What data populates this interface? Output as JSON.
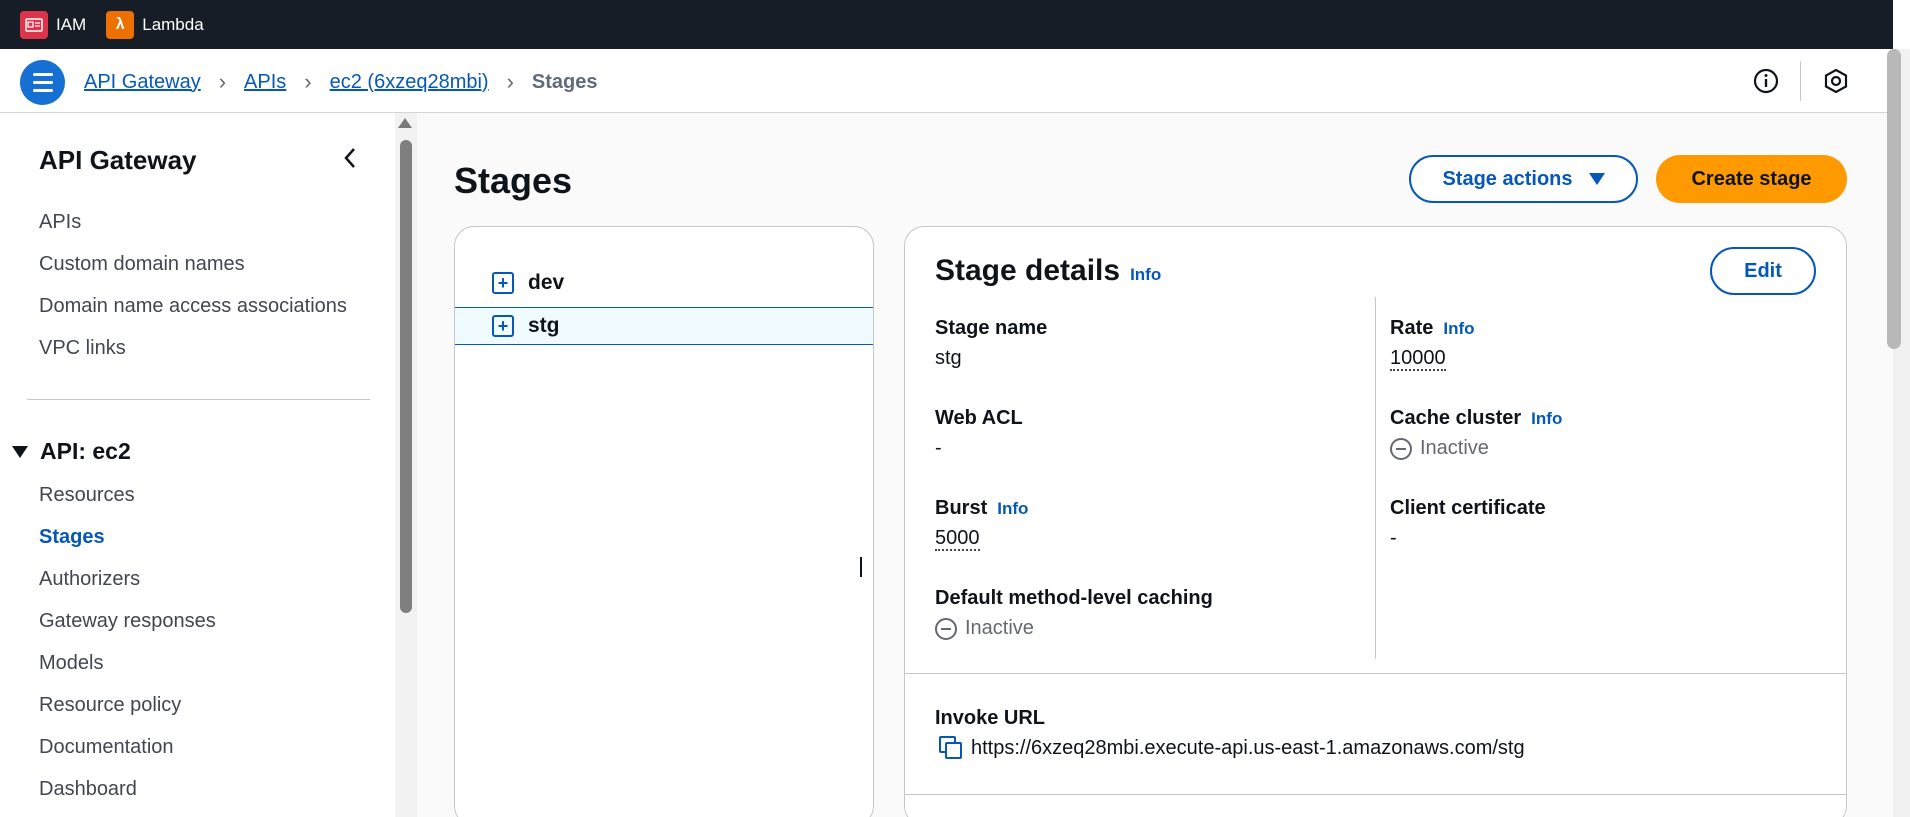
{
  "topbar": {
    "services": [
      {
        "label": "IAM",
        "icon": "iam-icon"
      },
      {
        "label": "Lambda",
        "icon": "lambda-icon"
      }
    ]
  },
  "breadcrumb": {
    "items": [
      "API Gateway",
      "APIs",
      "ec2 (6xzeq28mbi)"
    ],
    "current": "Stages"
  },
  "sidebar": {
    "title": "API Gateway",
    "top_items": [
      "APIs",
      "Custom domain names",
      "Domain name access associations",
      "VPC links"
    ],
    "section_title": "API: ec2",
    "section_items": [
      "Resources",
      "Stages",
      "Authorizers",
      "Gateway responses",
      "Models",
      "Resource policy",
      "Documentation",
      "Dashboard"
    ],
    "active_item": "Stages"
  },
  "main": {
    "title": "Stages",
    "stage_actions_label": "Stage actions",
    "create_stage_label": "Create stage",
    "stages": [
      "dev",
      "stg"
    ],
    "selected_stage": "stg"
  },
  "details": {
    "title": "Stage details",
    "info": "Info",
    "edit_label": "Edit",
    "stage_name_label": "Stage name",
    "stage_name": "stg",
    "web_acl_label": "Web ACL",
    "web_acl": "-",
    "burst_label": "Burst",
    "burst": "5000",
    "caching_label": "Default method-level caching",
    "caching": "Inactive",
    "rate_label": "Rate",
    "rate": "10000",
    "cache_cluster_label": "Cache cluster",
    "cache_cluster": "Inactive",
    "client_cert_label": "Client certificate",
    "client_cert": "-",
    "invoke_url_label": "Invoke URL",
    "invoke_url": "https://6xzeq28mbi.execute-api.us-east-1.amazonaws.com/stg"
  },
  "colors": {
    "accent": "#0558b6",
    "primary_button": "#ff9900",
    "topbar": "#161d26",
    "menu_button": "#1670d3"
  }
}
